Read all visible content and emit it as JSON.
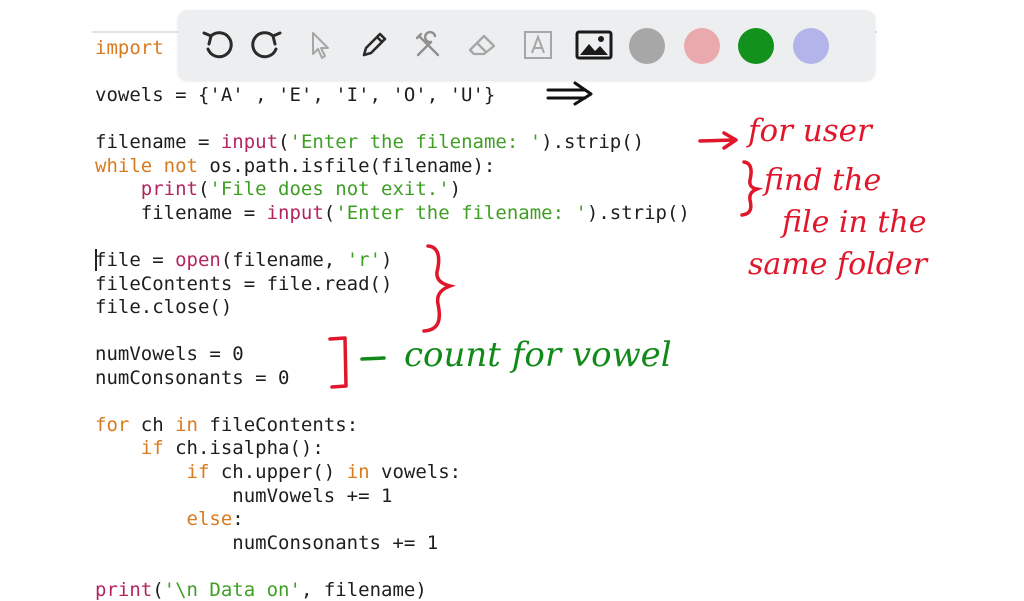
{
  "toolbar": {
    "tools": [
      "undo-icon",
      "redo-icon",
      "select-arrow-icon",
      "pen-icon",
      "tools-icon",
      "eraser-icon",
      "text-icon",
      "image-icon"
    ],
    "colors": [
      "#a7a7a7",
      "#eaa9ad",
      "#12911c",
      "#b3b5ea"
    ]
  },
  "code": {
    "l1": "import",
    "l2": "vowels = {'A' , 'E', 'I', 'O', 'U'}",
    "l3_a": "filename = ",
    "l3_b": "input",
    "l3_c": "(",
    "l3_d": "'Enter the filename: '",
    "l3_e": ").strip()",
    "l4_a": "while not",
    "l4_b": " os.path.isfile(filename):",
    "l5_a": "    ",
    "l5_b": "print",
    "l5_c": "(",
    "l5_d": "'File does not exit.'",
    "l5_e": ")",
    "l6_a": "    filename = ",
    "l6_b": "input",
    "l6_c": "(",
    "l6_d": "'Enter the filename: '",
    "l6_e": ").strip()",
    "l7_a": "file = ",
    "l7_b": "open",
    "l7_c": "(filename, ",
    "l7_d": "'r'",
    "l7_e": ")",
    "l8": "fileContents = file.read()",
    "l9": "file.close()",
    "l10": "numVowels = 0",
    "l11": "numConsonants = 0",
    "l12_a": "for",
    "l12_b": " ch ",
    "l12_c": "in",
    "l12_d": " fileContents:",
    "l13_a": "    ",
    "l13_b": "if",
    "l13_c": " ch.isalpha():",
    "l14_a": "        ",
    "l14_b": "if",
    "l14_c": " ch.upper() ",
    "l14_d": "in",
    "l14_e": " vowels:",
    "l15": "            numVowels += 1",
    "l16_a": "        ",
    "l16_b": "else",
    "l16_c": ":",
    "l17": "            numConsonants += 1",
    "l18_a": "print",
    "l18_b": "(",
    "l18_c": "'\\n Data on'",
    "l18_d": ", filename)"
  },
  "annotations": {
    "for_user": "for user",
    "find_1": "find the",
    "find_2": "file in the",
    "find_3": "same folder",
    "count": "count for vowel",
    "red": "#e0162b",
    "green": "#118a1a"
  }
}
